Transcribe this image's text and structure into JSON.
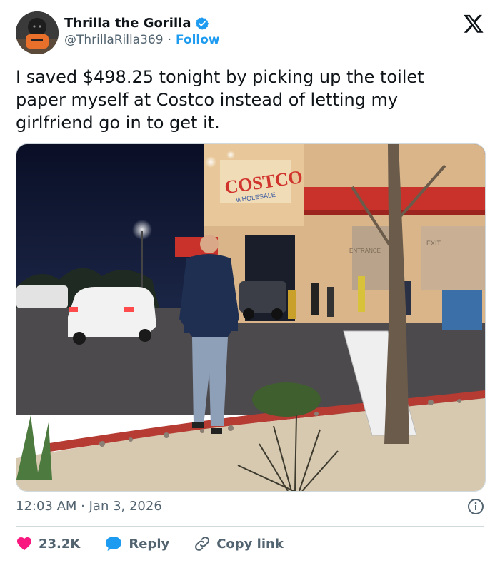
{
  "author": {
    "display_name": "Thrilla the Gorilla",
    "handle": "@ThrillaRilla369",
    "separator": "·",
    "follow_label": "Follow",
    "verified": true
  },
  "tweet": {
    "text": "I saved $498.25 tonight by picking up the toilet paper myself at Costco instead of letting my girlfriend go in to get it.",
    "timestamp": "12:03 AM · Jan 3, 2026"
  },
  "media": {
    "sign_main": "COSTCO",
    "sign_sub": "WHOLESALE",
    "entrance_label": "ENTRANCE",
    "exit_label": "EXIT"
  },
  "actions": {
    "like_count": "23.2K",
    "reply_label": "Reply",
    "copy_label": "Copy link"
  },
  "colors": {
    "like": "#f91880",
    "reply": "#1d9bf0",
    "follow": "#1d9bf0",
    "text_secondary": "#536471"
  },
  "icons": [
    "verified-badge-icon",
    "x-logo-icon",
    "info-icon",
    "heart-icon",
    "reply-bubble-icon",
    "link-icon"
  ]
}
